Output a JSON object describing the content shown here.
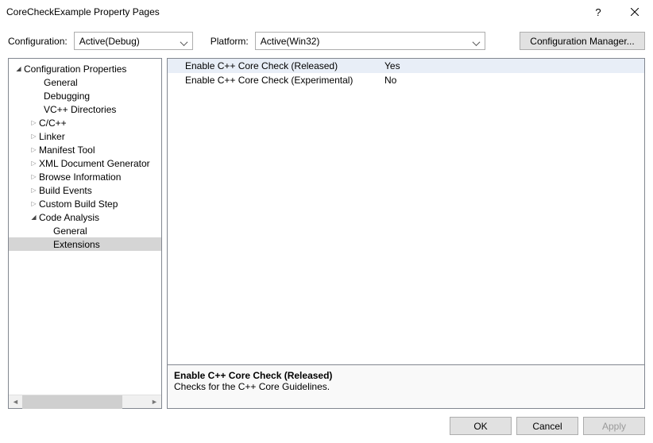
{
  "window": {
    "title": "CoreCheckExample Property Pages"
  },
  "configRow": {
    "configurationLabel": "Configuration:",
    "configurationValue": "Active(Debug)",
    "platformLabel": "Platform:",
    "platformValue": "Active(Win32)",
    "configurationManagerLabel": "Configuration Manager..."
  },
  "tree": {
    "root": "Configuration Properties",
    "items": [
      {
        "label": "General"
      },
      {
        "label": "Debugging"
      },
      {
        "label": "VC++ Directories"
      },
      {
        "label": "C/C++"
      },
      {
        "label": "Linker"
      },
      {
        "label": "Manifest Tool"
      },
      {
        "label": "XML Document Generator"
      },
      {
        "label": "Browse Information"
      },
      {
        "label": "Build Events"
      },
      {
        "label": "Custom Build Step"
      },
      {
        "label": "Code Analysis"
      }
    ],
    "codeAnalysisChildren": [
      {
        "label": "General"
      },
      {
        "label": "Extensions"
      }
    ]
  },
  "properties": {
    "rows": [
      {
        "name": "Enable C++ Core Check (Released)",
        "value": "Yes"
      },
      {
        "name": "Enable C++ Core Check (Experimental)",
        "value": "No"
      }
    ]
  },
  "description": {
    "title": "Enable C++ Core Check (Released)",
    "text": "Checks for the C++ Core Guidelines."
  },
  "buttons": {
    "ok": "OK",
    "cancel": "Cancel",
    "apply": "Apply"
  }
}
